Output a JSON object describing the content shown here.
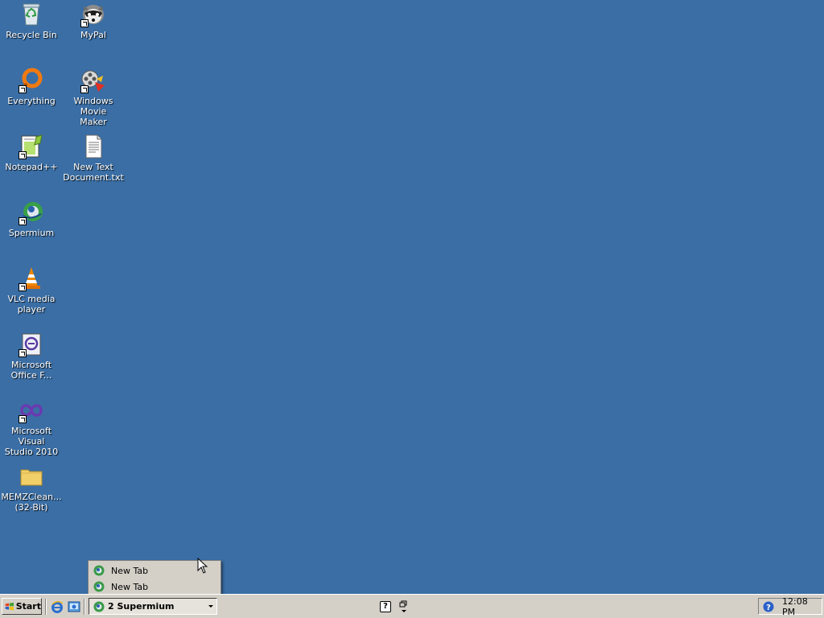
{
  "desktop": {
    "icons": [
      {
        "label": "Recycle Bin"
      },
      {
        "label": "MyPal"
      },
      {
        "label": "Everything"
      },
      {
        "label": "Windows Movie\nMaker"
      },
      {
        "label": "Notepad++"
      },
      {
        "label": "New Text\nDocument.txt"
      },
      {
        "label": "Spermium"
      },
      {
        "label": "VLC media\nplayer"
      },
      {
        "label": "Microsoft\nOffice F..."
      },
      {
        "label": "Microsoft Visual\nStudio 2010"
      },
      {
        "label": "MEMZClean...\n(32-Bit)"
      }
    ]
  },
  "popup": {
    "items": [
      {
        "label": "New Tab"
      },
      {
        "label": "New Tab"
      }
    ]
  },
  "taskbar": {
    "start_label": "Start",
    "task_button_label": "2 Supermium",
    "help_glyph": "?",
    "clock": "12:08 PM"
  },
  "colors": {
    "desktop_background": "#3a6ea5",
    "taskbar": "#d4d0c8"
  }
}
